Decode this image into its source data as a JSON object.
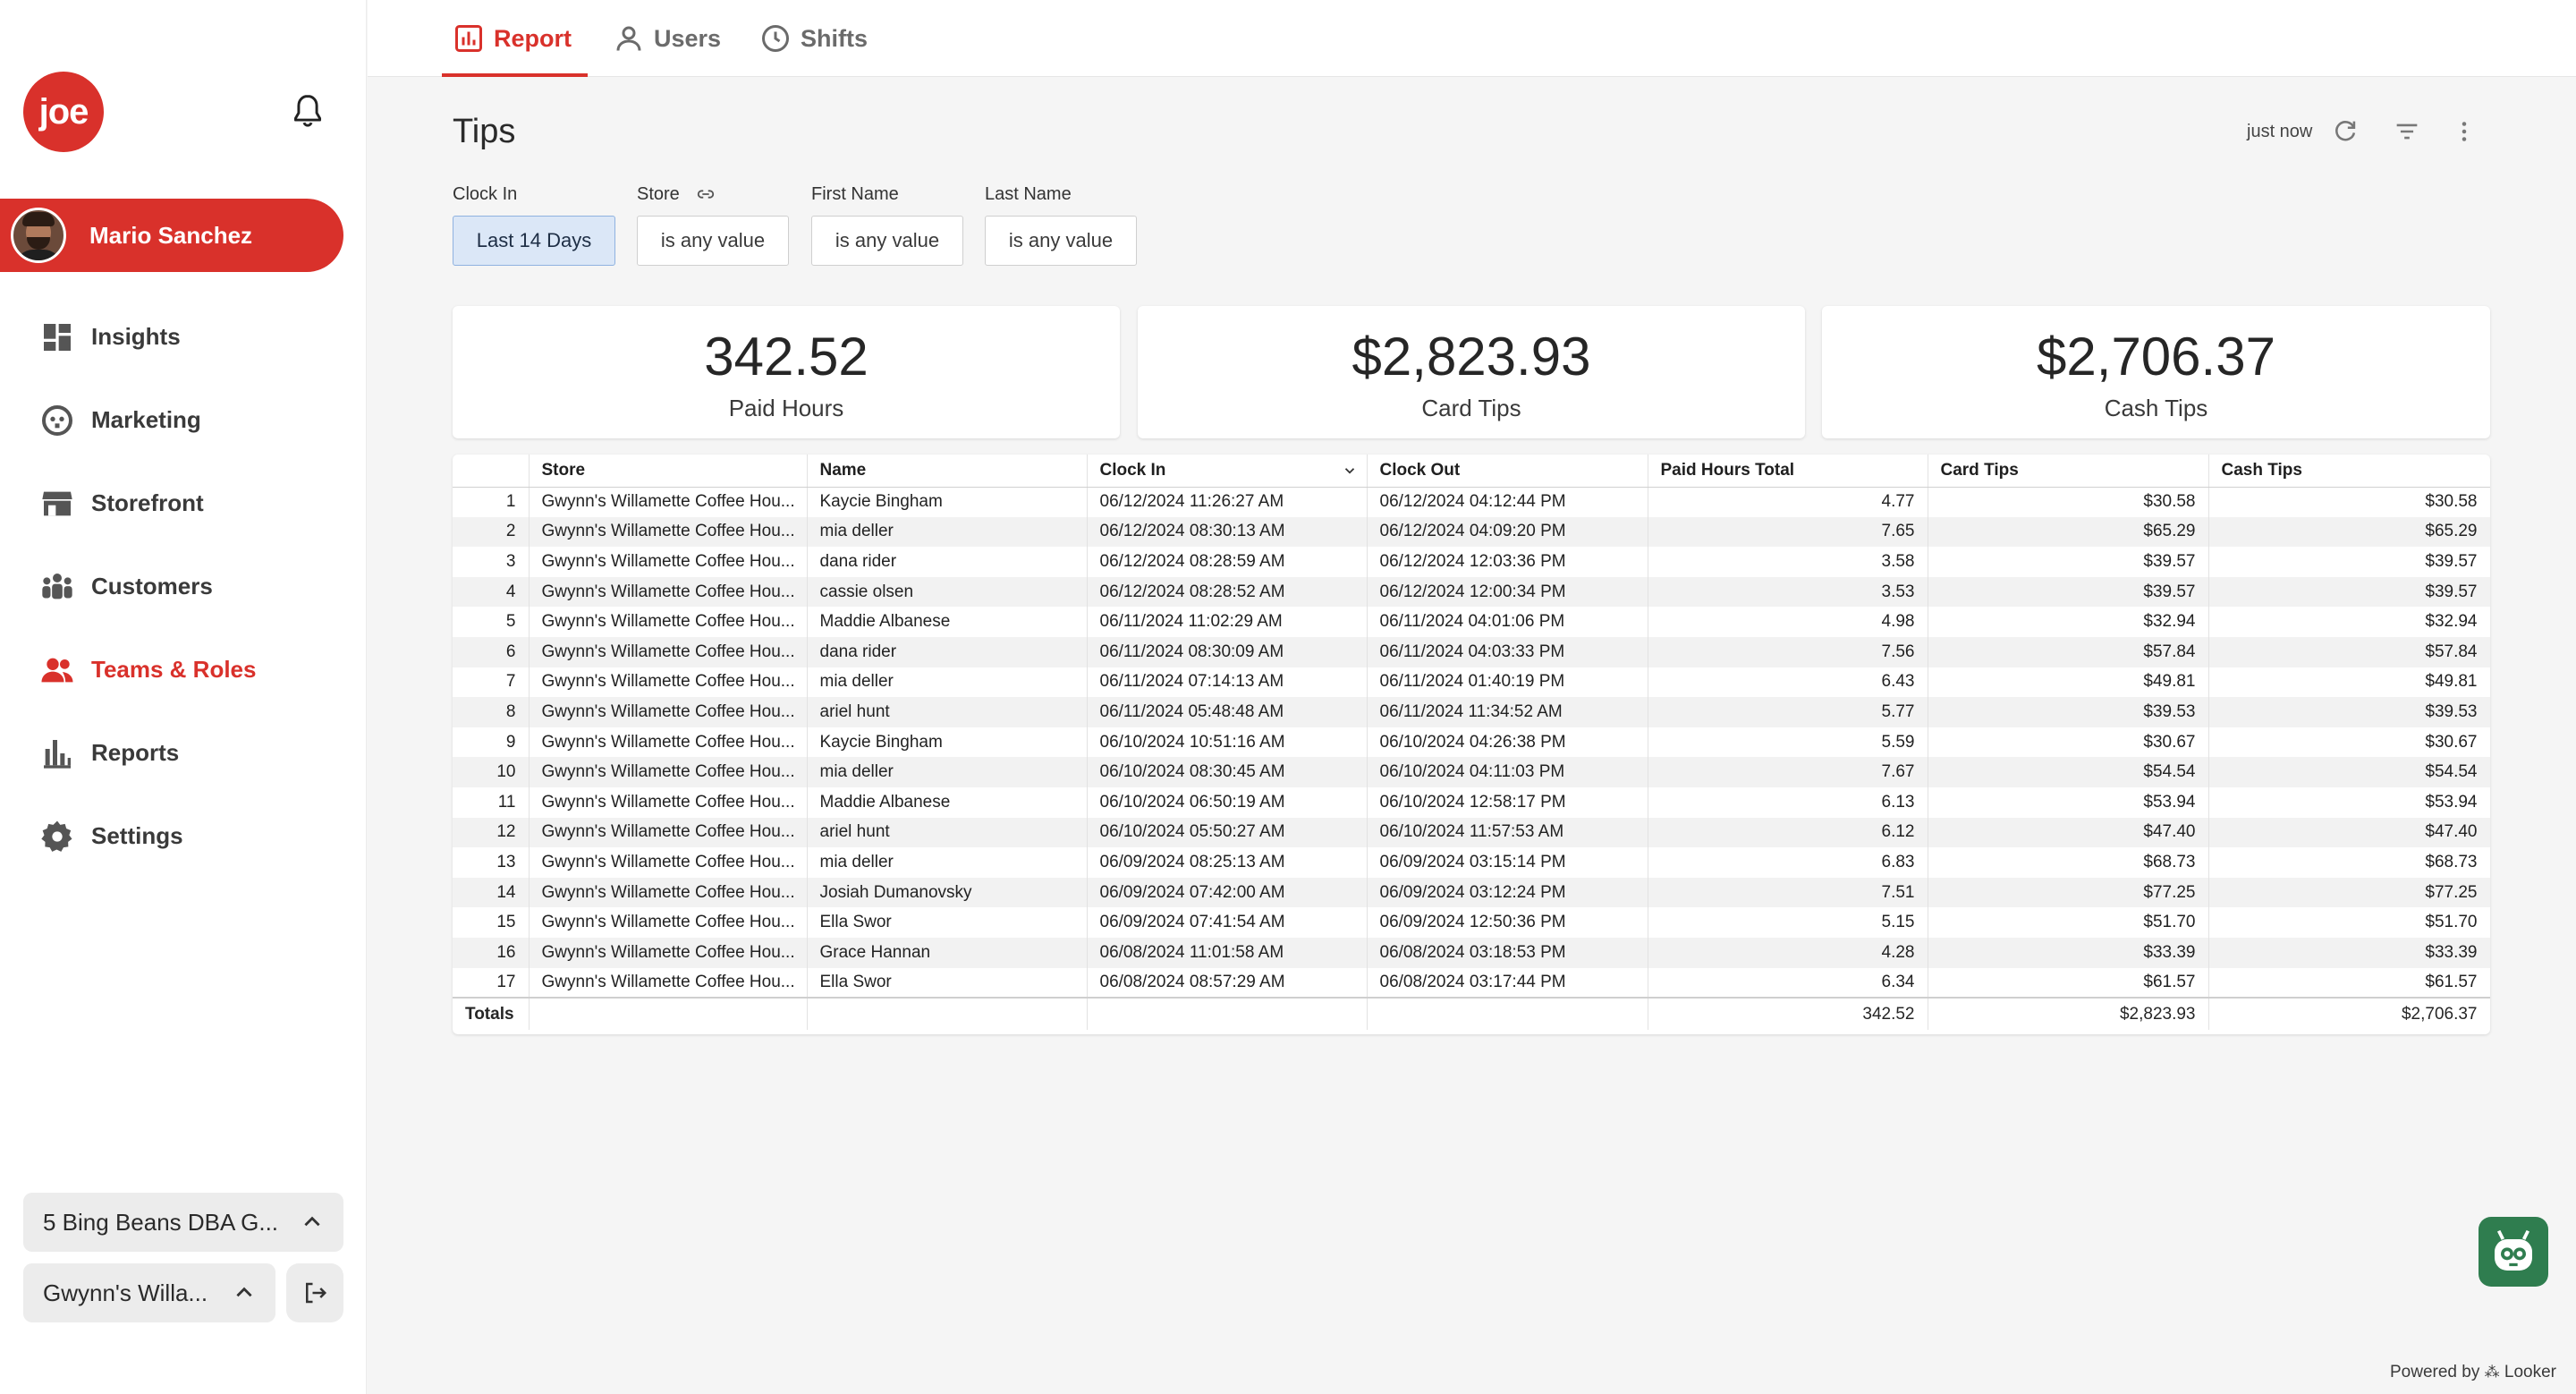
{
  "sidebar": {
    "logo_text": "joe",
    "user_name": "Mario Sanchez",
    "nav": [
      {
        "label": "Insights",
        "icon": "dashboard-icon"
      },
      {
        "label": "Marketing",
        "icon": "marketing-icon"
      },
      {
        "label": "Storefront",
        "icon": "storefront-icon"
      },
      {
        "label": "Customers",
        "icon": "customers-icon"
      },
      {
        "label": "Teams & Roles",
        "icon": "teams-icon"
      },
      {
        "label": "Reports",
        "icon": "reports-icon"
      },
      {
        "label": "Settings",
        "icon": "gear-icon"
      }
    ],
    "org_select": "5 Bing Beans DBA G...",
    "store_select": "Gwynn's Willa..."
  },
  "tabs": [
    {
      "label": "Report",
      "icon": "bar-chart-icon"
    },
    {
      "label": "Users",
      "icon": "user-icon"
    },
    {
      "label": "Shifts",
      "icon": "clock-icon"
    }
  ],
  "dashboard": {
    "title": "Tips",
    "refresh_label": "just now",
    "filters": [
      {
        "label": "Clock In",
        "value": "Last 14 Days"
      },
      {
        "label": "Store",
        "value": "is any value"
      },
      {
        "label": "First Name",
        "value": "is any value"
      },
      {
        "label": "Last Name",
        "value": "is any value"
      }
    ],
    "kpis": [
      {
        "value": "342.52",
        "label": "Paid Hours"
      },
      {
        "value": "$2,823.93",
        "label": "Card Tips"
      },
      {
        "value": "$2,706.37",
        "label": "Cash Tips"
      }
    ]
  },
  "table": {
    "columns": [
      "",
      "Store",
      "Name",
      "Clock In",
      "Clock Out",
      "Paid Hours Total",
      "Card Tips",
      "Cash Tips"
    ],
    "rows": [
      [
        "1",
        "Gwynn's Willamette Coffee Hou...",
        "Kaycie Bingham",
        "06/12/2024 11:26:27 AM",
        "06/12/2024 04:12:44 PM",
        "4.77",
        "$30.58",
        "$30.58"
      ],
      [
        "2",
        "Gwynn's Willamette Coffee Hou...",
        "mia deller",
        "06/12/2024 08:30:13 AM",
        "06/12/2024 04:09:20 PM",
        "7.65",
        "$65.29",
        "$65.29"
      ],
      [
        "3",
        "Gwynn's Willamette Coffee Hou...",
        "dana rider",
        "06/12/2024 08:28:59 AM",
        "06/12/2024 12:03:36 PM",
        "3.58",
        "$39.57",
        "$39.57"
      ],
      [
        "4",
        "Gwynn's Willamette Coffee Hou...",
        "cassie olsen",
        "06/12/2024 08:28:52 AM",
        "06/12/2024 12:00:34 PM",
        "3.53",
        "$39.57",
        "$39.57"
      ],
      [
        "5",
        "Gwynn's Willamette Coffee Hou...",
        "Maddie Albanese",
        "06/11/2024 11:02:29 AM",
        "06/11/2024 04:01:06 PM",
        "4.98",
        "$32.94",
        "$32.94"
      ],
      [
        "6",
        "Gwynn's Willamette Coffee Hou...",
        "dana rider",
        "06/11/2024 08:30:09 AM",
        "06/11/2024 04:03:33 PM",
        "7.56",
        "$57.84",
        "$57.84"
      ],
      [
        "7",
        "Gwynn's Willamette Coffee Hou...",
        "mia deller",
        "06/11/2024 07:14:13 AM",
        "06/11/2024 01:40:19 PM",
        "6.43",
        "$49.81",
        "$49.81"
      ],
      [
        "8",
        "Gwynn's Willamette Coffee Hou...",
        "ariel hunt",
        "06/11/2024 05:48:48 AM",
        "06/11/2024 11:34:52 AM",
        "5.77",
        "$39.53",
        "$39.53"
      ],
      [
        "9",
        "Gwynn's Willamette Coffee Hou...",
        "Kaycie Bingham",
        "06/10/2024 10:51:16 AM",
        "06/10/2024 04:26:38 PM",
        "5.59",
        "$30.67",
        "$30.67"
      ],
      [
        "10",
        "Gwynn's Willamette Coffee Hou...",
        "mia deller",
        "06/10/2024 08:30:45 AM",
        "06/10/2024 04:11:03 PM",
        "7.67",
        "$54.54",
        "$54.54"
      ],
      [
        "11",
        "Gwynn's Willamette Coffee Hou...",
        "Maddie Albanese",
        "06/10/2024 06:50:19 AM",
        "06/10/2024 12:58:17 PM",
        "6.13",
        "$53.94",
        "$53.94"
      ],
      [
        "12",
        "Gwynn's Willamette Coffee Hou...",
        "ariel hunt",
        "06/10/2024 05:50:27 AM",
        "06/10/2024 11:57:53 AM",
        "6.12",
        "$47.40",
        "$47.40"
      ],
      [
        "13",
        "Gwynn's Willamette Coffee Hou...",
        "mia deller",
        "06/09/2024 08:25:13 AM",
        "06/09/2024 03:15:14 PM",
        "6.83",
        "$68.73",
        "$68.73"
      ],
      [
        "14",
        "Gwynn's Willamette Coffee Hou...",
        "Josiah Dumanovsky",
        "06/09/2024 07:42:00 AM",
        "06/09/2024 03:12:24 PM",
        "7.51",
        "$77.25",
        "$77.25"
      ],
      [
        "15",
        "Gwynn's Willamette Coffee Hou...",
        "Ella Swor",
        "06/09/2024 07:41:54 AM",
        "06/09/2024 12:50:36 PM",
        "5.15",
        "$51.70",
        "$51.70"
      ],
      [
        "16",
        "Gwynn's Willamette Coffee Hou...",
        "Grace Hannan",
        "06/08/2024 11:01:58 AM",
        "06/08/2024 03:18:53 PM",
        "4.28",
        "$33.39",
        "$33.39"
      ],
      [
        "17",
        "Gwynn's Willamette Coffee Hou...",
        "Ella Swor",
        "06/08/2024 08:57:29 AM",
        "06/08/2024 03:17:44 PM",
        "6.34",
        "$61.57",
        "$61.57"
      ]
    ],
    "totals": {
      "label": "Totals",
      "paid_hours": "342.52",
      "card_tips": "$2,823.93",
      "cash_tips": "$2,706.37"
    }
  },
  "footer": {
    "powered_by": "Powered by",
    "looker": "Looker"
  },
  "colors": {
    "brand": "#d9312b",
    "filter_selected_bg": "#dbe7f7",
    "row_alt": "#f2f2f2"
  }
}
